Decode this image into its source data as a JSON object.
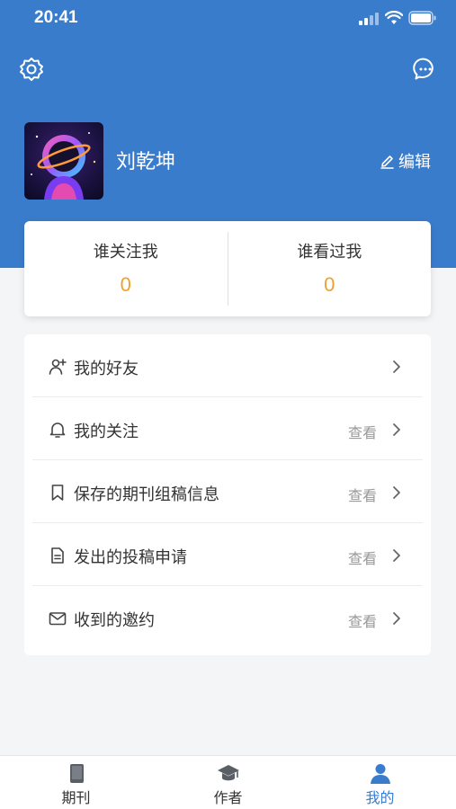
{
  "status_bar": {
    "time": "20:41"
  },
  "header": {
    "settings_icon": "gear-icon",
    "message_icon": "chat-bubble-icon"
  },
  "profile": {
    "name": "刘乾坤",
    "edit_label": "编辑",
    "avatar": "astronaut-avatar"
  },
  "stats": [
    {
      "label": "谁关注我",
      "value": "0"
    },
    {
      "label": "谁看过我",
      "value": "0"
    }
  ],
  "menu": [
    {
      "label": "我的好友",
      "action": "",
      "icon": "add-user-icon"
    },
    {
      "label": "我的关注",
      "action": "查看",
      "icon": "bell-icon"
    },
    {
      "label": "保存的期刊组稿信息",
      "action": "查看",
      "icon": "bookmark-icon"
    },
    {
      "label": "发出的投稿申请",
      "action": "查看",
      "icon": "document-icon"
    },
    {
      "label": "收到的邀约",
      "action": "查看",
      "icon": "mail-icon"
    }
  ],
  "tabs": [
    {
      "label": "期刊",
      "icon": "book-icon",
      "active": false
    },
    {
      "label": "作者",
      "icon": "graduation-cap-icon",
      "active": false
    },
    {
      "label": "我的",
      "icon": "person-icon",
      "active": true
    }
  ],
  "colors": {
    "brand": "#3a7ccc",
    "stat_value": "#f0a030",
    "muted": "#999999"
  }
}
